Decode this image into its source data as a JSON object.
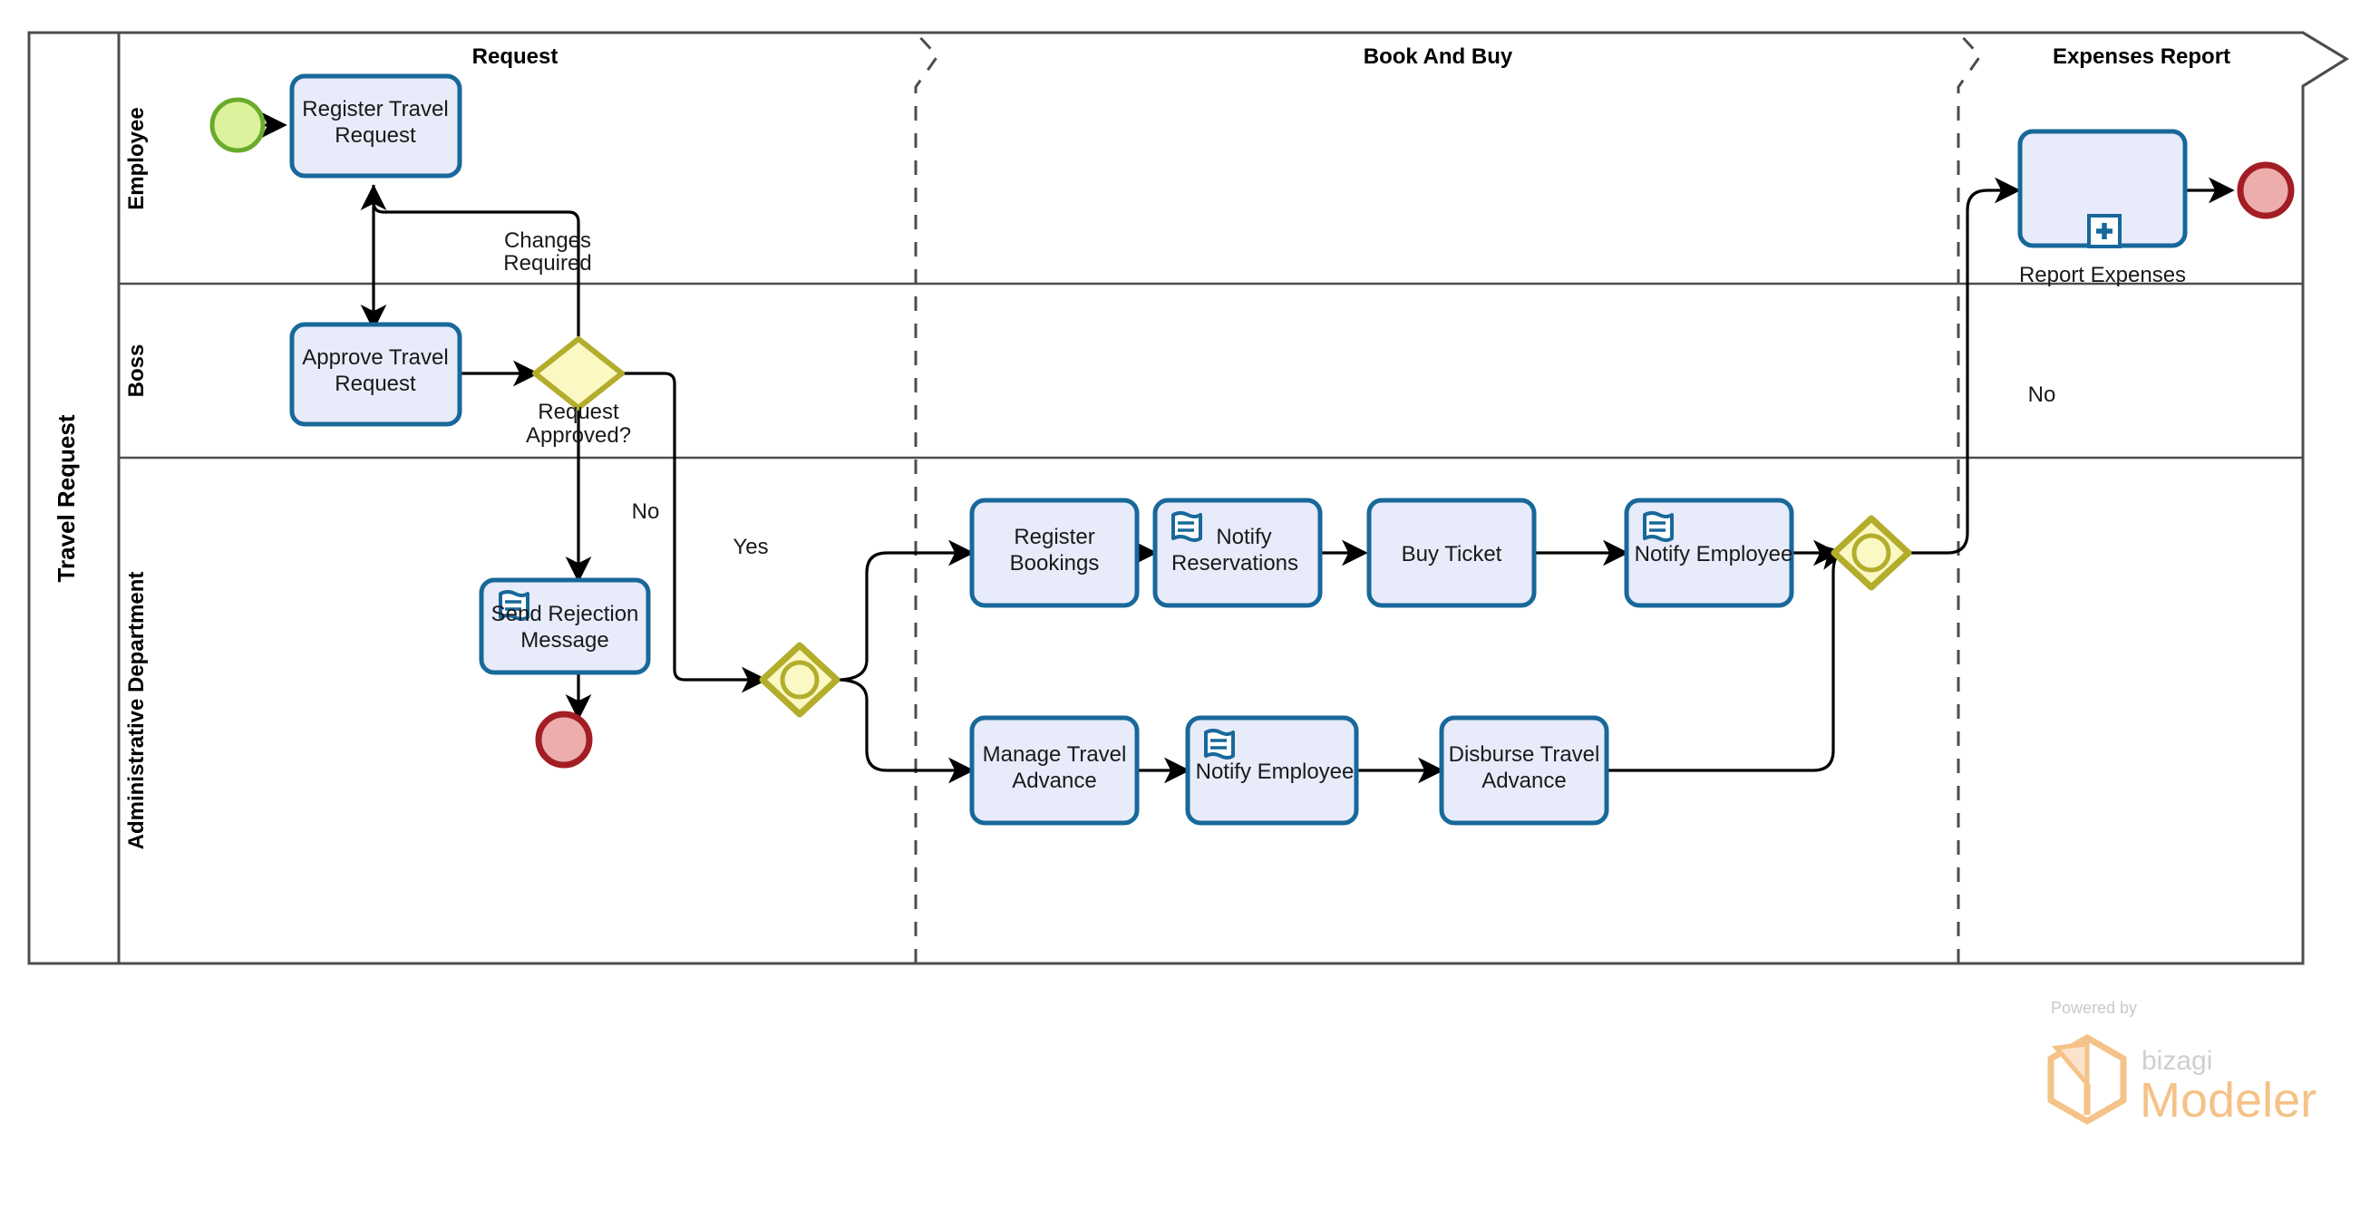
{
  "diagram": {
    "type": "bpmn-process-diagram",
    "pool": {
      "name": "Travel Request"
    },
    "lanes": [
      {
        "id": "employee",
        "name": "Employee"
      },
      {
        "id": "boss",
        "name": "Boss"
      },
      {
        "id": "admin",
        "name": "Administrative Department"
      }
    ],
    "phases": [
      {
        "id": "request",
        "name": "Request"
      },
      {
        "id": "book-and-buy",
        "name": "Book And Buy"
      },
      {
        "id": "expenses-report",
        "name": "Expenses Report"
      }
    ],
    "events": [
      {
        "id": "start",
        "kind": "start-event",
        "lane": "employee",
        "label": ""
      },
      {
        "id": "end-rejected",
        "kind": "end-event",
        "lane": "admin",
        "label": ""
      },
      {
        "id": "end-done",
        "kind": "end-event",
        "lane": "employee",
        "label": ""
      }
    ],
    "tasks": [
      {
        "id": "register-travel-request",
        "label": "Register Travel Request",
        "marker": "none",
        "lane": "employee",
        "phase": "request"
      },
      {
        "id": "approve-travel-request",
        "label": "Approve Travel Request",
        "marker": "none",
        "lane": "boss",
        "phase": "request"
      },
      {
        "id": "send-rejection-message",
        "label": "Send Rejection Message",
        "marker": "script",
        "lane": "admin",
        "phase": "request"
      },
      {
        "id": "register-bookings",
        "label": "Register Bookings",
        "marker": "none",
        "lane": "admin",
        "phase": "book-and-buy"
      },
      {
        "id": "notify-reservations",
        "label": "Notify Reservations",
        "marker": "script",
        "lane": "admin",
        "phase": "book-and-buy"
      },
      {
        "id": "buy-ticket",
        "label": "Buy Ticket",
        "marker": "none",
        "lane": "admin",
        "phase": "book-and-buy"
      },
      {
        "id": "notify-employee-top",
        "label": "Notify Employee",
        "marker": "script",
        "lane": "admin",
        "phase": "book-and-buy"
      },
      {
        "id": "manage-travel-advance",
        "label": "Manage Travel Advance",
        "marker": "none",
        "lane": "admin",
        "phase": "book-and-buy"
      },
      {
        "id": "notify-employee-bottom",
        "label": "Notify Employee",
        "marker": "script",
        "lane": "admin",
        "phase": "book-and-buy"
      },
      {
        "id": "disburse-travel-advance",
        "label": "Disburse Travel Advance",
        "marker": "none",
        "lane": "admin",
        "phase": "book-and-buy"
      },
      {
        "id": "report-expenses",
        "label": "Report Expenses",
        "marker": "subprocess-plus",
        "lane": "employee",
        "phase": "expenses-report"
      }
    ],
    "gateways": [
      {
        "id": "request-approved",
        "kind": "exclusive",
        "label": "Request Approved?",
        "lane": "boss",
        "phase": "request"
      },
      {
        "id": "split-inclusive",
        "kind": "inclusive",
        "label": "",
        "lane": "admin",
        "phase": "request"
      },
      {
        "id": "join-inclusive",
        "kind": "inclusive",
        "label": "",
        "lane": "admin",
        "phase": "book-and-buy"
      }
    ],
    "flow_labels": [
      {
        "id": "changes-required",
        "text": "Changes Required"
      },
      {
        "id": "no-rejection",
        "text": "No"
      },
      {
        "id": "yes-approved",
        "text": "Yes"
      },
      {
        "id": "no-expenses",
        "text": "No"
      }
    ],
    "colors": {
      "task_fill": "#e7ebfa",
      "task_stroke": "#18689a",
      "gateway_fill": "#fbf8c3",
      "gateway_stroke": "#b3ad2c",
      "start_fill": "#ddf29c",
      "start_stroke": "#6aab2b",
      "end_fill": "#eeadad",
      "end_stroke": "#a31d24",
      "pool_stroke": "#4d4d4d",
      "flow_stroke": "#000000",
      "accent_brand": "#f5c287"
    }
  },
  "branding": {
    "powered_by": "Powered by",
    "product_prefix": "bizagi",
    "product_name": "Modeler"
  }
}
